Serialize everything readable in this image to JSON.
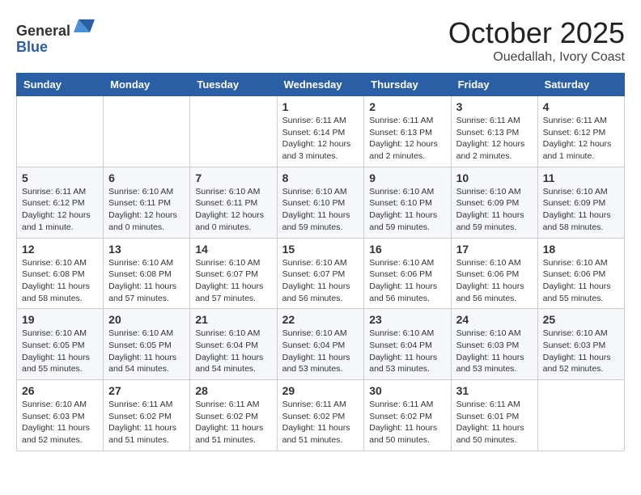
{
  "header": {
    "logo_general": "General",
    "logo_blue": "Blue",
    "month_title": "October 2025",
    "location": "Ouedallah, Ivory Coast"
  },
  "calendar": {
    "days_of_week": [
      "Sunday",
      "Monday",
      "Tuesday",
      "Wednesday",
      "Thursday",
      "Friday",
      "Saturday"
    ],
    "weeks": [
      [
        {
          "day": "",
          "info": ""
        },
        {
          "day": "",
          "info": ""
        },
        {
          "day": "",
          "info": ""
        },
        {
          "day": "1",
          "info": "Sunrise: 6:11 AM\nSunset: 6:14 PM\nDaylight: 12 hours and 3 minutes."
        },
        {
          "day": "2",
          "info": "Sunrise: 6:11 AM\nSunset: 6:13 PM\nDaylight: 12 hours and 2 minutes."
        },
        {
          "day": "3",
          "info": "Sunrise: 6:11 AM\nSunset: 6:13 PM\nDaylight: 12 hours and 2 minutes."
        },
        {
          "day": "4",
          "info": "Sunrise: 6:11 AM\nSunset: 6:12 PM\nDaylight: 12 hours and 1 minute."
        }
      ],
      [
        {
          "day": "5",
          "info": "Sunrise: 6:11 AM\nSunset: 6:12 PM\nDaylight: 12 hours and 1 minute."
        },
        {
          "day": "6",
          "info": "Sunrise: 6:10 AM\nSunset: 6:11 PM\nDaylight: 12 hours and 0 minutes."
        },
        {
          "day": "7",
          "info": "Sunrise: 6:10 AM\nSunset: 6:11 PM\nDaylight: 12 hours and 0 minutes."
        },
        {
          "day": "8",
          "info": "Sunrise: 6:10 AM\nSunset: 6:10 PM\nDaylight: 11 hours and 59 minutes."
        },
        {
          "day": "9",
          "info": "Sunrise: 6:10 AM\nSunset: 6:10 PM\nDaylight: 11 hours and 59 minutes."
        },
        {
          "day": "10",
          "info": "Sunrise: 6:10 AM\nSunset: 6:09 PM\nDaylight: 11 hours and 59 minutes."
        },
        {
          "day": "11",
          "info": "Sunrise: 6:10 AM\nSunset: 6:09 PM\nDaylight: 11 hours and 58 minutes."
        }
      ],
      [
        {
          "day": "12",
          "info": "Sunrise: 6:10 AM\nSunset: 6:08 PM\nDaylight: 11 hours and 58 minutes."
        },
        {
          "day": "13",
          "info": "Sunrise: 6:10 AM\nSunset: 6:08 PM\nDaylight: 11 hours and 57 minutes."
        },
        {
          "day": "14",
          "info": "Sunrise: 6:10 AM\nSunset: 6:07 PM\nDaylight: 11 hours and 57 minutes."
        },
        {
          "day": "15",
          "info": "Sunrise: 6:10 AM\nSunset: 6:07 PM\nDaylight: 11 hours and 56 minutes."
        },
        {
          "day": "16",
          "info": "Sunrise: 6:10 AM\nSunset: 6:06 PM\nDaylight: 11 hours and 56 minutes."
        },
        {
          "day": "17",
          "info": "Sunrise: 6:10 AM\nSunset: 6:06 PM\nDaylight: 11 hours and 56 minutes."
        },
        {
          "day": "18",
          "info": "Sunrise: 6:10 AM\nSunset: 6:06 PM\nDaylight: 11 hours and 55 minutes."
        }
      ],
      [
        {
          "day": "19",
          "info": "Sunrise: 6:10 AM\nSunset: 6:05 PM\nDaylight: 11 hours and 55 minutes."
        },
        {
          "day": "20",
          "info": "Sunrise: 6:10 AM\nSunset: 6:05 PM\nDaylight: 11 hours and 54 minutes."
        },
        {
          "day": "21",
          "info": "Sunrise: 6:10 AM\nSunset: 6:04 PM\nDaylight: 11 hours and 54 minutes."
        },
        {
          "day": "22",
          "info": "Sunrise: 6:10 AM\nSunset: 6:04 PM\nDaylight: 11 hours and 53 minutes."
        },
        {
          "day": "23",
          "info": "Sunrise: 6:10 AM\nSunset: 6:04 PM\nDaylight: 11 hours and 53 minutes."
        },
        {
          "day": "24",
          "info": "Sunrise: 6:10 AM\nSunset: 6:03 PM\nDaylight: 11 hours and 53 minutes."
        },
        {
          "day": "25",
          "info": "Sunrise: 6:10 AM\nSunset: 6:03 PM\nDaylight: 11 hours and 52 minutes."
        }
      ],
      [
        {
          "day": "26",
          "info": "Sunrise: 6:10 AM\nSunset: 6:03 PM\nDaylight: 11 hours and 52 minutes."
        },
        {
          "day": "27",
          "info": "Sunrise: 6:11 AM\nSunset: 6:02 PM\nDaylight: 11 hours and 51 minutes."
        },
        {
          "day": "28",
          "info": "Sunrise: 6:11 AM\nSunset: 6:02 PM\nDaylight: 11 hours and 51 minutes."
        },
        {
          "day": "29",
          "info": "Sunrise: 6:11 AM\nSunset: 6:02 PM\nDaylight: 11 hours and 51 minutes."
        },
        {
          "day": "30",
          "info": "Sunrise: 6:11 AM\nSunset: 6:02 PM\nDaylight: 11 hours and 50 minutes."
        },
        {
          "day": "31",
          "info": "Sunrise: 6:11 AM\nSunset: 6:01 PM\nDaylight: 11 hours and 50 minutes."
        },
        {
          "day": "",
          "info": ""
        }
      ]
    ]
  }
}
